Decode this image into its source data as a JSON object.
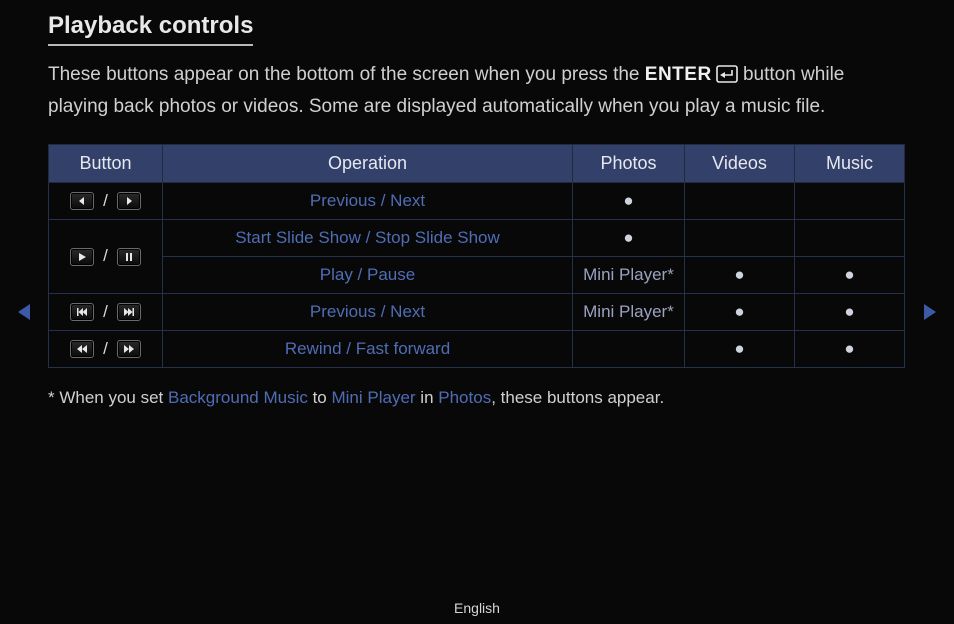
{
  "title": "Playback controls",
  "intro_before": "These buttons appear on the bottom of the screen when you press the ",
  "enter_label": "ENTER",
  "intro_after": " button while playing back photos or videos. Some are displayed automatically when you play a music file.",
  "headers": {
    "button": "Button",
    "operation": "Operation",
    "photos": "Photos",
    "videos": "Videos",
    "music": "Music"
  },
  "dot": "●",
  "sep": "/",
  "rows": [
    {
      "icon1": "step-left-icon",
      "icon2": "step-right-icon",
      "operation": "Previous / Next",
      "photos": "●",
      "videos": "",
      "music": ""
    },
    {
      "icon1": "play-icon",
      "icon2": "pause-icon",
      "operation": "Start Slide Show / Stop Slide Show",
      "photos": "●",
      "videos": "",
      "music": ""
    },
    {
      "icon1": "",
      "icon2": "",
      "operation": "Play / Pause",
      "photos": "Mini Player*",
      "videos": "●",
      "music": "●"
    },
    {
      "icon1": "skip-prev-icon",
      "icon2": "skip-next-icon",
      "operation": "Previous / Next",
      "photos": "Mini Player*",
      "videos": "●",
      "music": "●"
    },
    {
      "icon1": "rewind-icon",
      "icon2": "fast-forward-icon",
      "operation": "Rewind / Fast forward",
      "photos": "",
      "videos": "●",
      "music": "●"
    }
  ],
  "footnote": {
    "t1": "* When you set ",
    "l1": "Background Music",
    "t2": " to ",
    "l2": "Mini Player",
    "t3": " in ",
    "l3": "Photos",
    "t4": ", these buttons appear."
  },
  "lang": "English"
}
